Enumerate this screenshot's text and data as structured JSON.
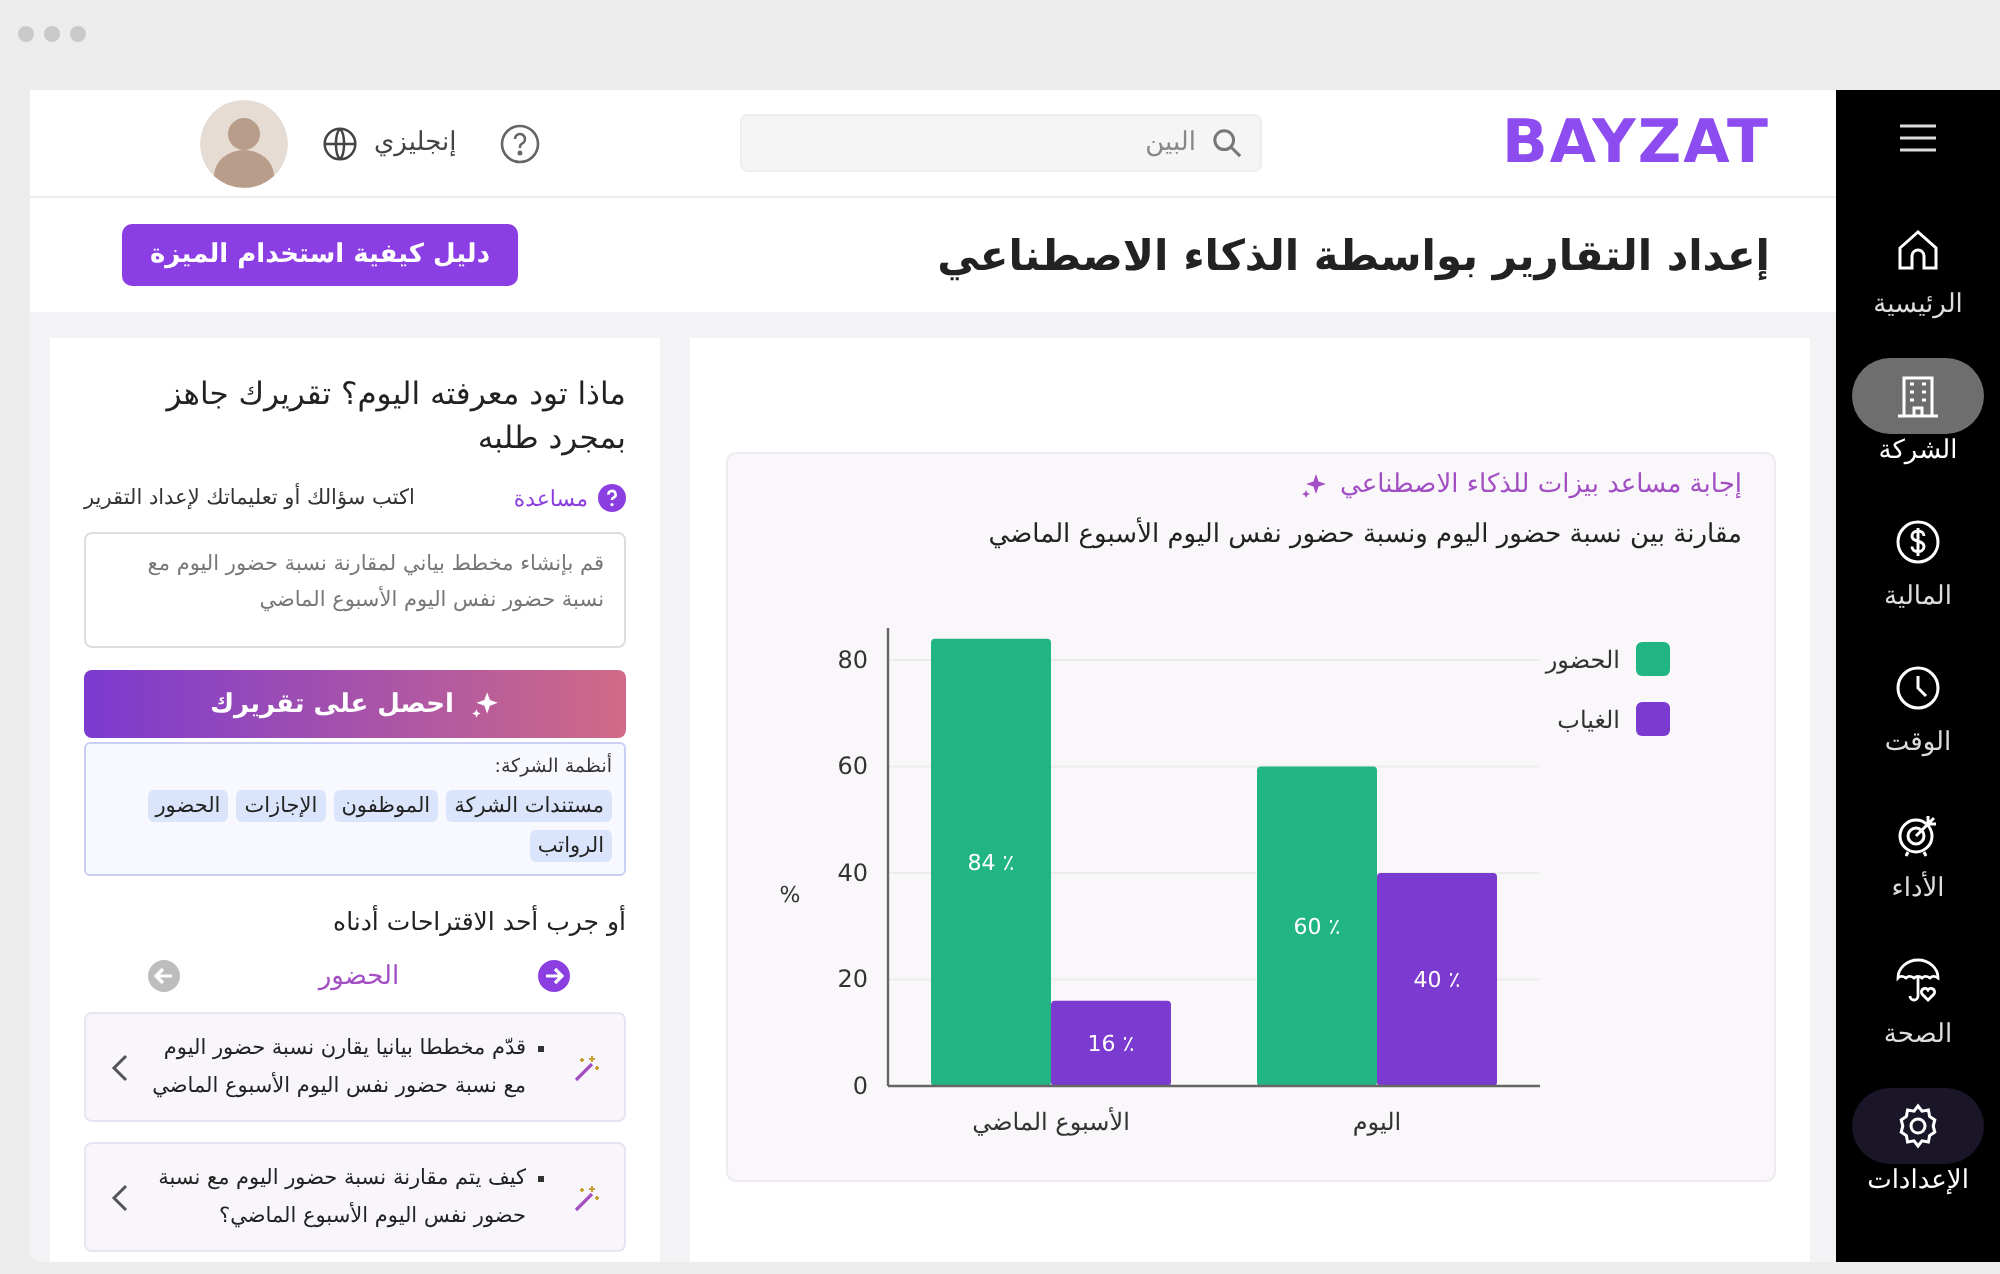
{
  "header": {
    "logo": "BAYZAT",
    "search": {
      "placeholder": "البين"
    },
    "language": "إنجليزي"
  },
  "sidebar": {
    "items": [
      {
        "label": "الرئيسية",
        "selected": false,
        "highlighted": false
      },
      {
        "label": "الشركة",
        "selected": true,
        "highlighted": false
      },
      {
        "label": "المالية",
        "selected": false,
        "highlighted": false
      },
      {
        "label": "الوقت",
        "selected": false,
        "highlighted": false
      },
      {
        "label": "الأداء",
        "selected": false,
        "highlighted": false
      },
      {
        "label": "الصحة",
        "selected": false,
        "highlighted": false
      },
      {
        "label": "الإعدادات",
        "selected": false,
        "highlighted": true
      }
    ]
  },
  "page": {
    "title": "إعداد التقارير بواسطة الذكاء الاصطناعي",
    "guide_button": "دليل كيفية استخدام الميزة"
  },
  "prompt_panel": {
    "heading": "ماذا تود معرفته اليوم؟ تقريرك جاهز بمجرد طلبه",
    "help_link": "مساعدة",
    "instruction": "اكتب سؤالك أو تعليماتك لإعداد التقرير",
    "input": {
      "placeholder": "قم بإنشاء مخطط بياني لمقارنة نسبة حضور اليوم مع نسبة حضور نفس اليوم الأسبوع الماضي"
    },
    "submit_button": "احصل على تقريرك",
    "systems": {
      "label": "أنظمة الشركة:",
      "tags": [
        "مستندات الشركة",
        "الموظفون",
        "الإجازات",
        "الحضور",
        "الرواتب"
      ]
    },
    "suggestions_heading": "أو جرب أحد الاقتراحات أدناه",
    "carousel": {
      "category": "الحضور",
      "arrows": [
        {
          "kind": "next",
          "disabled": false
        },
        {
          "kind": "prev",
          "disabled": true
        }
      ]
    },
    "suggestions": [
      "قدّم مخططا بيانيا يقارن نسبة حضور اليوم مع نسبة حضور نفس اليوم الأسبوع الماضي",
      "كيف يتم مقارنة نسبة حضور اليوم مع نسبة حضور نفس اليوم الأسبوع الماضي؟"
    ]
  },
  "answer_panel": {
    "title": "إجابة مساعد بيزات للذكاء الاصطناعي",
    "subtitle": "مقارنة بين نسبة حضور اليوم ونسبة حضور نفس اليوم الأسبوع الماضي",
    "chart_data": {
      "type": "bar",
      "ylabel": "%",
      "categories": [
        "الأسبوع الماضي",
        "اليوم"
      ],
      "series": [
        {
          "name": "الحضور",
          "color": "#22b584",
          "values": [
            84,
            60
          ]
        },
        {
          "name": "الغياب",
          "color": "#7b3ad0",
          "values": [
            16,
            40
          ]
        }
      ],
      "ylim": [
        0,
        86
      ],
      "yticks": [
        0,
        20,
        40,
        60,
        80
      ],
      "grid": true,
      "legend": true,
      "value_labels": [
        [
          "84 ٪",
          "60 ٪"
        ],
        [
          "16 ٪",
          "40 ٪"
        ]
      ]
    }
  }
}
